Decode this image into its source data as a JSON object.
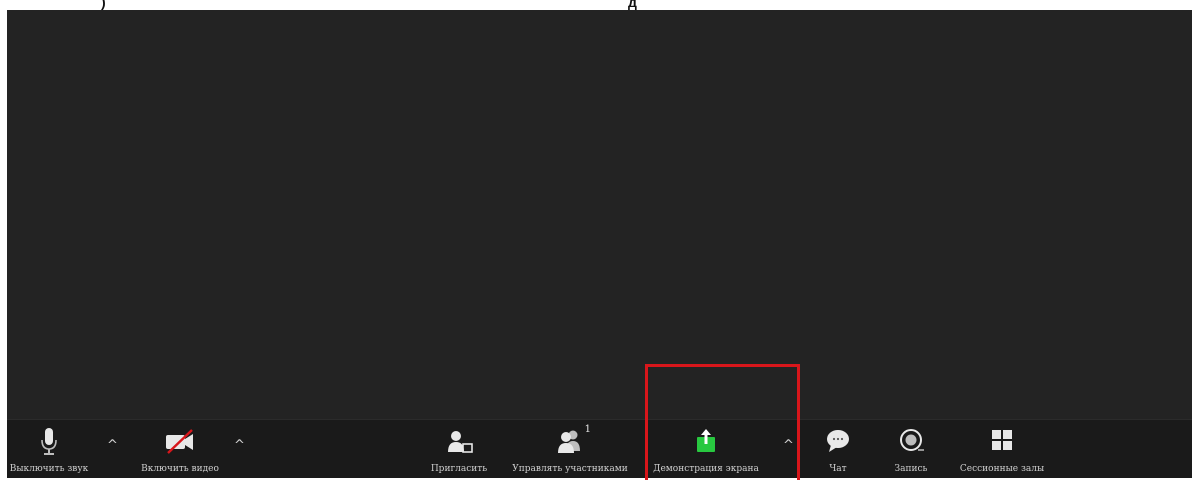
{
  "top_text": {
    "left": ")",
    "right": "д"
  },
  "toolbar": {
    "mute_label": "Выключить звук",
    "video_label": "Включить видео",
    "invite_label": "Пригласить",
    "participants_label": "Управлять участниками",
    "participants_count": "1",
    "share_label": "Демонстрация экрана",
    "chat_label": "Чат",
    "record_label": "Запись",
    "breakout_label": "Сессионные залы",
    "caret": "^"
  },
  "colors": {
    "background": "#232323",
    "toolbar": "#1a1a1a",
    "share_green": "#28c840",
    "highlight_red": "#d8161b",
    "video_off_red": "#d8161b"
  }
}
